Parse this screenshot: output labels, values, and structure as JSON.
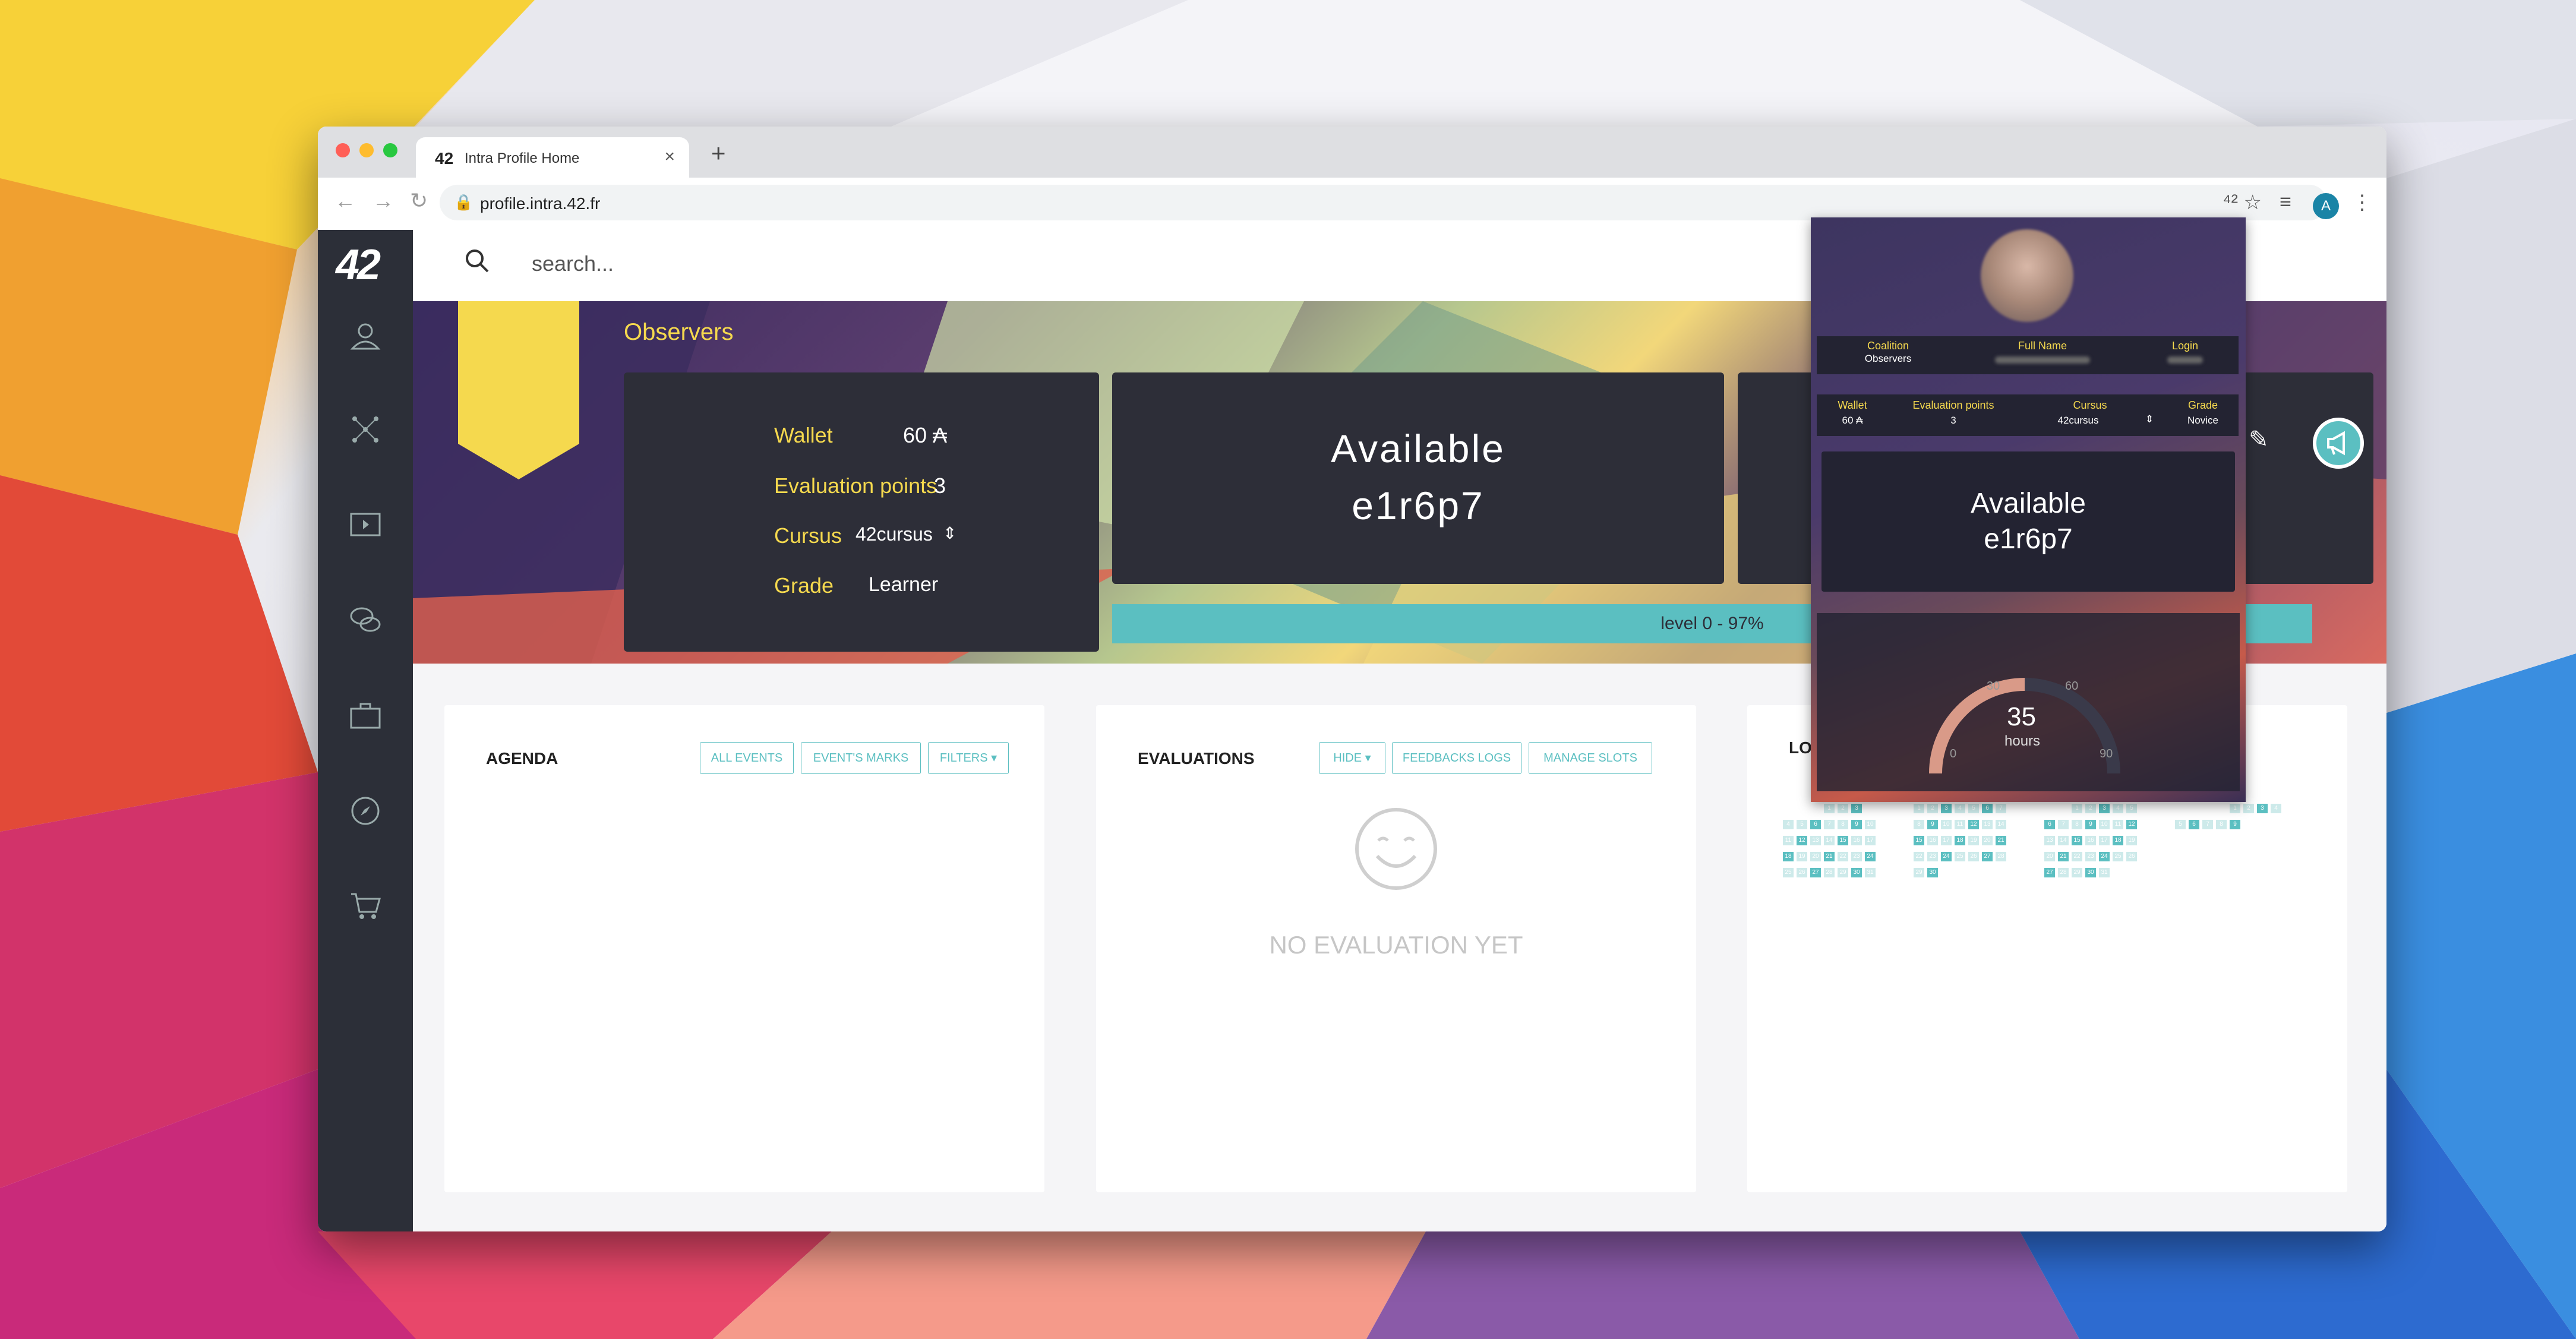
{
  "browser": {
    "tab_title": "Intra Profile Home",
    "tab_favicon": "42",
    "new_tab": "+",
    "close_tab": "×",
    "url": "profile.intra.42.fr",
    "profile_initial": "A"
  },
  "app": {
    "logo": "42",
    "search_placeholder": "search..."
  },
  "profile": {
    "coalition": "Observers",
    "wallet_label": "Wallet",
    "wallet_value": "60 ₳",
    "eval_label": "Evaluation points",
    "eval_value": "3",
    "cursus_label": "Cursus",
    "cursus_value": "42cursus",
    "grade_label": "Grade",
    "grade_value": "Learner",
    "available_line1": "Available",
    "available_line2": "e1r6p7",
    "level": "level 0 - 97%",
    "level_progress": 0.97
  },
  "panels": {
    "agenda": {
      "title": "AGENDA",
      "buttons": [
        "ALL EVENTS",
        "EVENT'S MARKS",
        "FILTERS ▾"
      ]
    },
    "evaluations": {
      "title": "EVALUATIONS",
      "buttons": [
        "HIDE ▾",
        "FEEDBACKS LOGS",
        "MANAGE SLOTS"
      ],
      "empty": "NO EVALUATION YET"
    },
    "logtime": {
      "title": "LO"
    }
  },
  "calendar": {
    "months": [
      [
        [
          "",
          "",
          "",
          "1",
          "2",
          "3",
          ""
        ],
        [
          "4",
          "5",
          "6",
          "7",
          "8",
          "9",
          "10"
        ],
        [
          "11",
          "12",
          "13",
          "14",
          "15",
          "16",
          "17"
        ],
        [
          "18",
          "19",
          "20",
          "21",
          "22",
          "23",
          "24"
        ],
        [
          "25",
          "26",
          "27",
          "28",
          "29",
          "30",
          "31"
        ]
      ],
      [
        [
          "1",
          "2",
          "3",
          "4",
          "5",
          "6",
          "7"
        ],
        [
          "8",
          "9",
          "10",
          "11",
          "12",
          "13",
          "14"
        ],
        [
          "15",
          "16",
          "17",
          "18",
          "19",
          "20",
          "21"
        ],
        [
          "22",
          "23",
          "24",
          "25",
          "26",
          "27",
          "28"
        ],
        [
          "29",
          "30",
          "",
          "",
          "",
          "",
          ""
        ]
      ],
      [
        [
          "",
          "",
          "1",
          "2",
          "3",
          "4",
          "5"
        ],
        [
          "6",
          "7",
          "8",
          "9",
          "10",
          "11",
          "12"
        ],
        [
          "13",
          "14",
          "15",
          "16",
          "17",
          "18",
          "19"
        ],
        [
          "20",
          "21",
          "22",
          "23",
          "24",
          "25",
          "26"
        ],
        [
          "27",
          "28",
          "29",
          "30",
          "31",
          "",
          ""
        ]
      ],
      [
        [
          "",
          "",
          "",
          "",
          "1",
          "2",
          "3",
          "4"
        ],
        [
          "5",
          "6",
          "7",
          "8",
          "9",
          "",
          "",
          ""
        ]
      ]
    ]
  },
  "popup": {
    "coalition_label": "Coalition",
    "coalition_value": "Observers",
    "fullname_label": "Full Name",
    "login_label": "Login",
    "wallet_label": "Wallet",
    "wallet_value": "60 ₳",
    "eval_label": "Evaluation points",
    "eval_value": "3",
    "cursus_label": "Cursus",
    "cursus_value": "42cursus",
    "grade_label": "Grade",
    "grade_value": "Novice",
    "available_line1": "Available",
    "available_line2": "e1r6p7",
    "hours_value": "35",
    "hours_unit": "hours",
    "gauge_ticks": [
      "0",
      "30",
      "60",
      "90"
    ]
  },
  "colors": {
    "accent": "#5bbfc1",
    "yellow": "#f5d94e",
    "sidebar": "#2c2f38",
    "card": "#2d2e38"
  }
}
